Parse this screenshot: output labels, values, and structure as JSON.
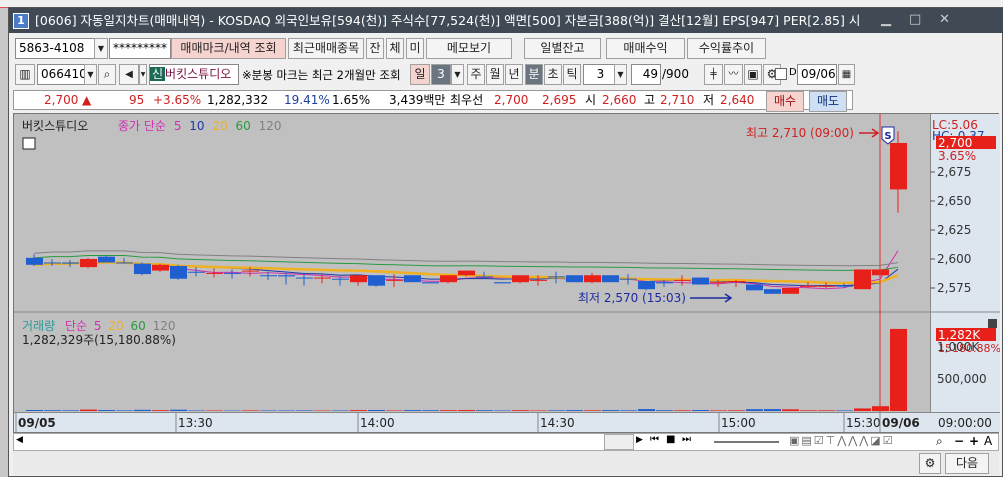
{
  "title": {
    "number": "1",
    "text": "[0606] 자동일지차트(매매내역) - KOSDAQ 외국인보유[594(천)] 주식수[77,524(천)] 액면[500] 자본금[388(억)] 결산[12월] EPS[947] PER[2.85] 시"
  },
  "toolbar1": {
    "account": "5863-4108",
    "password": "*********",
    "trade_mark_query": "매매마크/내역 조회",
    "recent_items": "최근매매종목",
    "jan": "잔",
    "che": "체",
    "mi": "미",
    "memo": "메모보기",
    "daily_balance": "일별잔고",
    "trade_profit": "매매수익",
    "return_trend": "수익률추이"
  },
  "toolbar2": {
    "code": "066410",
    "credit_badge": "신",
    "stock_name": "버킷스튜디오",
    "notice": "※분봉 마크는 최근 2개월만 조회",
    "period_day": "일",
    "day_count": "3",
    "week": "주",
    "month": "월",
    "year": "년",
    "minute": "분",
    "second": "초",
    "tick": "틱",
    "interval": "3",
    "count": "49",
    "count_total": "/900",
    "d_label": "D",
    "date": "09/06"
  },
  "info": {
    "price": "2,700",
    "arrow": "▲",
    "change": "95",
    "change_pct": "+3.65%",
    "volume": "1,282,332",
    "ratio1": "19.41%",
    "ratio2": "1.65%",
    "amount": "3,439백만",
    "best_label": "최우선",
    "best_ask": "2,700",
    "best_bid": "2,695",
    "open_label": "시",
    "open": "2,660",
    "high_label": "고",
    "high": "2,710",
    "low_label": "저",
    "low": "2,640",
    "buy": "매수",
    "sell": "매도"
  },
  "price_panel": {
    "name": "버킷스튜디오",
    "ma_label": "종가 단순",
    "ma": [
      "5",
      "10",
      "20",
      "60",
      "120"
    ],
    "max_label": "최고 2,710 (09:00)",
    "min_label": "최저 2,570 (15:03)",
    "lc": "LC:5.06",
    "hc": "HC:-0.37",
    "cur_price": "2,700",
    "cur_pct": "3.65%",
    "sell_mark": "S"
  },
  "volume_panel": {
    "name": "거래량",
    "ma_label": "단순",
    "ma": [
      "5",
      "20",
      "60",
      "120"
    ],
    "summary": "1,282,329주(15,180.88%)",
    "cur_volume": "1,282K",
    "cur_pct": "15180.88%"
  },
  "colors": {
    "up": "#e8201a",
    "down": "#1f5fd0",
    "ma5": "#d030b0",
    "ma10": "#1c3aa8",
    "ma20": "#f0b020",
    "ma60": "#2a9a40",
    "ma120": "#808080"
  },
  "footer": {
    "next": "다음"
  },
  "chart_data": {
    "type": "candlestick",
    "price_ticks": [
      "2,575",
      "2,600",
      "2,625",
      "2,650",
      "2,675"
    ],
    "volume_ticks": [
      "500,000",
      "1,000K"
    ],
    "time_ticks": [
      "09/05",
      "13:30",
      "14:00",
      "14:30",
      "15:00",
      "15:30",
      "09/06"
    ],
    "cursor_time": "09:00:00",
    "candles": [
      [
        2601,
        2604,
        2594,
        2595
      ],
      [
        2597,
        2600,
        2594,
        2597
      ],
      [
        2597,
        2599,
        2593,
        2596
      ],
      [
        2593,
        2601,
        2592,
        2600
      ],
      [
        2602,
        2603,
        2597,
        2597
      ],
      [
        2597,
        2601,
        2596,
        2597
      ],
      [
        2596,
        2597,
        2586,
        2587
      ],
      [
        2590,
        2596,
        2589,
        2595
      ],
      [
        2594,
        2595,
        2582,
        2583
      ],
      [
        2589,
        2593,
        2585,
        2589
      ],
      [
        2588,
        2592,
        2584,
        2588
      ],
      [
        2588,
        2591,
        2583,
        2588
      ],
      [
        2590,
        2593,
        2585,
        2590
      ],
      [
        2586,
        2589,
        2582,
        2586
      ],
      [
        2586,
        2588,
        2578,
        2585
      ],
      [
        2584,
        2588,
        2577,
        2584
      ],
      [
        2584,
        2587,
        2579,
        2584
      ],
      [
        2583,
        2585,
        2577,
        2583
      ],
      [
        2580,
        2586,
        2577,
        2586
      ],
      [
        2586,
        2586,
        2576,
        2577
      ],
      [
        2582,
        2587,
        2576,
        2582
      ],
      [
        2586,
        2586,
        2580,
        2580
      ],
      [
        2580,
        2580,
        2579,
        2579
      ],
      [
        2580,
        2586,
        2579,
        2586
      ],
      [
        2586,
        2590,
        2585,
        2590
      ],
      [
        2585,
        2589,
        2583,
        2585
      ],
      [
        2580,
        2580,
        2579,
        2579
      ],
      [
        2580,
        2586,
        2579,
        2586
      ],
      [
        2582,
        2586,
        2577,
        2582
      ],
      [
        2585,
        2589,
        2579,
        2585
      ],
      [
        2586,
        2586,
        2580,
        2580
      ],
      [
        2580,
        2588,
        2579,
        2586
      ],
      [
        2586,
        2586,
        2580,
        2580
      ],
      [
        2583,
        2587,
        2578,
        2583
      ],
      [
        2581,
        2581,
        2573,
        2574
      ],
      [
        2580,
        2582,
        2576,
        2579
      ],
      [
        2582,
        2586,
        2577,
        2582
      ],
      [
        2584,
        2584,
        2578,
        2578
      ],
      [
        2580,
        2582,
        2576,
        2580
      ],
      [
        2580,
        2582,
        2576,
        2581
      ],
      [
        2578,
        2578,
        2573,
        2573
      ],
      [
        2574,
        2574,
        2570,
        2570
      ],
      [
        2570,
        2575,
        2570,
        2575
      ],
      [
        2576,
        2580,
        2575,
        2577
      ],
      [
        2576,
        2580,
        2575,
        2577
      ],
      [
        2577,
        2579,
        2575,
        2577
      ],
      [
        2574,
        2591,
        2574,
        2591
      ],
      [
        2586,
        2591,
        2586,
        2591
      ],
      [
        2660,
        2710,
        2640,
        2700
      ]
    ],
    "volumes": [
      15000,
      12000,
      10000,
      22000,
      15000,
      9000,
      18000,
      12000,
      20000,
      8000,
      8000,
      7000,
      9000,
      8000,
      8000,
      9000,
      7000,
      8000,
      14000,
      16000,
      8000,
      14000,
      12000,
      12000,
      15000,
      12000,
      8000,
      12000,
      8000,
      10000,
      14000,
      10000,
      14000,
      10000,
      30000,
      12000,
      10000,
      15000,
      9000,
      10000,
      28000,
      30000,
      26000,
      10000,
      10000,
      9000,
      40000,
      75000,
      1282329
    ]
  }
}
